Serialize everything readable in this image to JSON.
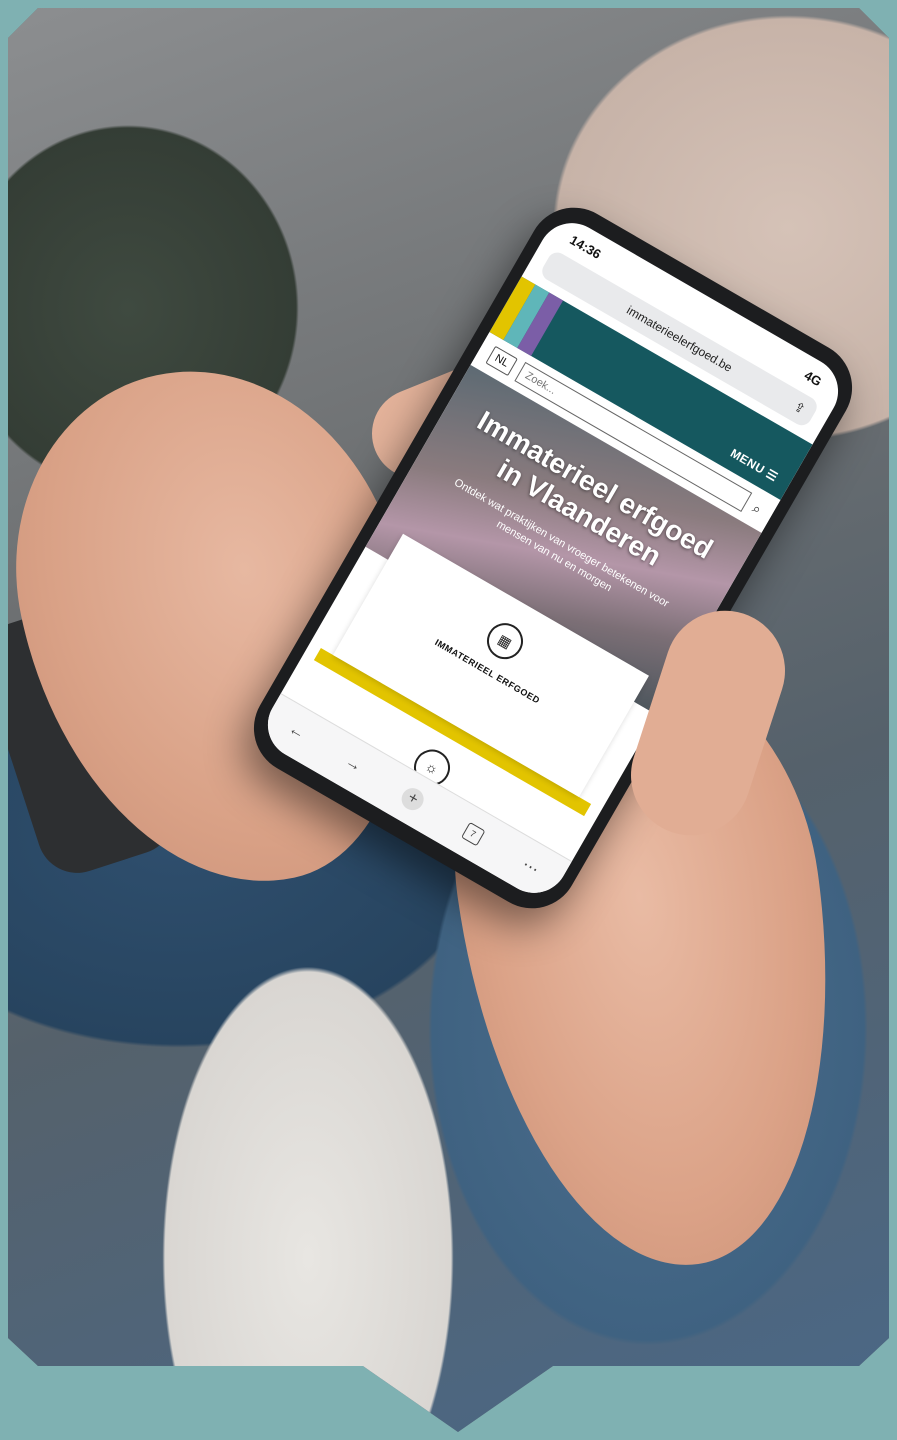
{
  "phone": {
    "time": "14:36",
    "signal": "4G",
    "url": "immaterieelerfgoed.be",
    "menu_label": "MENU ☰",
    "language": "NL",
    "search_placeholder": "Zoek...",
    "hero_title_line1": "Immaterieel erfgoed",
    "hero_title_line2": "in Vlaanderen",
    "hero_subtitle": "Ontdek wat praktijken van vroeger betekenen voor mensen van nu en morgen",
    "card_label": "IMMATERIEEL ERFGOED",
    "tab_count": "7"
  },
  "colors": {
    "background": "#7fb1b2",
    "header_teal": "#15585f",
    "stripe_yellow": "#e2c400",
    "stripe_cyan": "#5fb6b9",
    "stripe_purple": "#7b5ea7",
    "accent_yellow": "#e2c400"
  },
  "icons": {
    "grid": "grid-icon",
    "bulb": "lightbulb-icon",
    "search": "search-icon",
    "share": "share-icon"
  }
}
